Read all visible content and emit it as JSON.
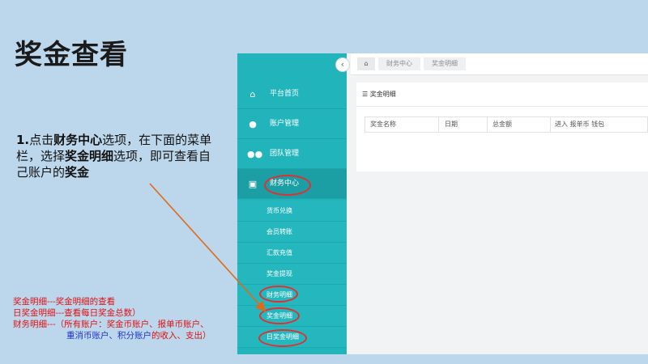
{
  "slide": {
    "title": "奖金查看",
    "instruction": {
      "step": "1.",
      "p1": "点击",
      "b1": "财务中心",
      "p2": "选项，在下面的菜单栏，选择",
      "b2": "奖金明细",
      "p3": "选项，即可查看自己账户的",
      "b3": "奖金"
    },
    "notes": [
      "奖金明细---奖金明细的查看",
      "日奖金明细---查看每日奖金总数）",
      "财务明细---（所有账户：奖金币账户、报单币账户、"
    ],
    "note_last": {
      "blue": "重消币账户、积分账户",
      "red": "的收入、支出）"
    }
  },
  "app": {
    "collapse_glyph": "‹",
    "sidebar": {
      "items": [
        {
          "icon": "home-icon",
          "glyph": "⌂",
          "label": "平台首页"
        },
        {
          "icon": "user-icon",
          "glyph": "●",
          "label": "账户管理"
        },
        {
          "icon": "team-icon",
          "glyph": "●●",
          "label": "团队管理"
        },
        {
          "icon": "money-icon",
          "glyph": "▣",
          "label": "财务中心"
        }
      ],
      "sub_items": [
        "货币兑换",
        "会员转账",
        "汇款充值",
        "奖金提现",
        "财务明细",
        "奖金明细",
        "日奖金明细"
      ]
    },
    "breadcrumb": [
      "财务中心",
      "奖金明细"
    ],
    "home_glyph": "⌂",
    "panel_title": "☰ 奖金明细",
    "table_headers": [
      "奖金名称",
      "日期",
      "总金额",
      "进入 报单币 钱包"
    ]
  },
  "colors": {
    "accent": "#22b4bb",
    "annotation": "#e03030",
    "note_blue": "#1f34c8"
  }
}
